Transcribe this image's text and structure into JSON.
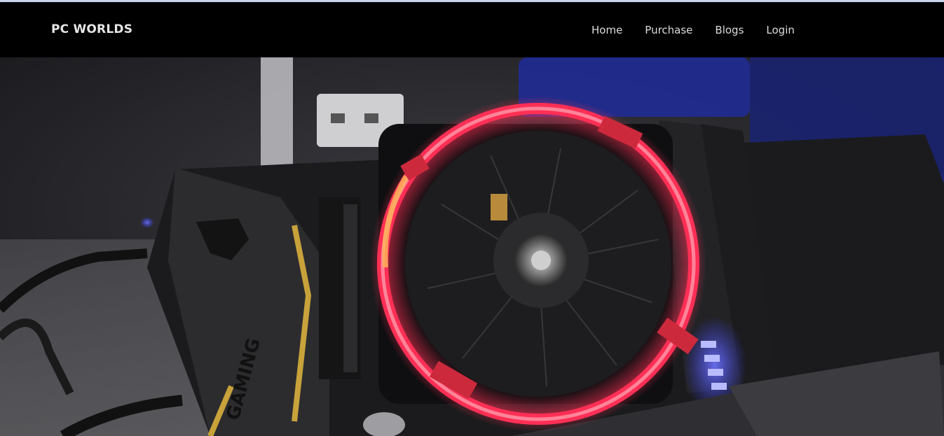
{
  "navbar": {
    "brand": "PC WORLDS",
    "links": [
      {
        "label": "Home"
      },
      {
        "label": "Purchase"
      },
      {
        "label": "Blogs"
      },
      {
        "label": "Login"
      }
    ]
  },
  "hero": {
    "image_subject": "RGB-lit CPU cooler with red ring on a gaming motherboard",
    "motherboard_logo": "GAMING",
    "colors": {
      "ring": "#ff2f55",
      "ring_glow": "#ff7a8f",
      "accent_blue": "#3a3fff",
      "board_trim": "#c8a23a",
      "background_blue": "#1e2a8a"
    }
  }
}
